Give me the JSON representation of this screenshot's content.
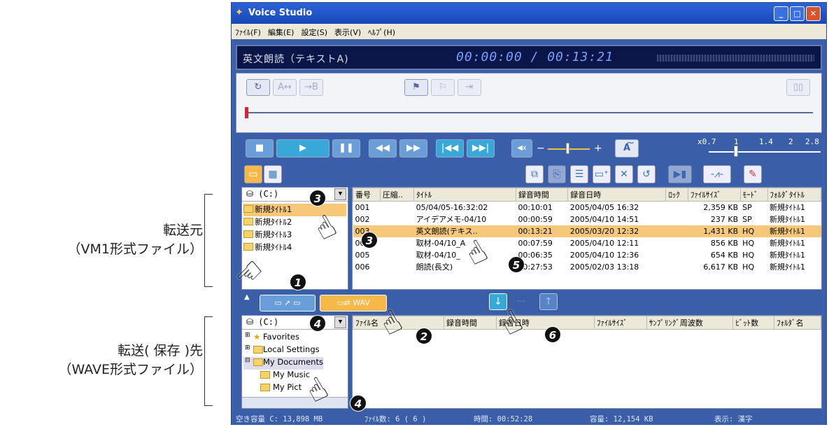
{
  "left_labels": {
    "source_line1": "転送元",
    "source_line2": "（VM1形式ファイル）",
    "dest_line1": "転送( 保存 )先",
    "dest_line2": "（WAVE形式ファイル）"
  },
  "window": {
    "title": "Voice Studio",
    "controls": [
      "_",
      "□",
      "✕"
    ]
  },
  "menu": [
    "ﾌｧｲﾙ(F)",
    "編集(E)",
    "設定(S)",
    "表示(V)",
    "ﾍﾙﾌﾟ(H)"
  ],
  "lcd": {
    "title": "英文朗読（テキストA)",
    "time": "00:00:00 / 00:13:21"
  },
  "speed_scale": {
    "labels": [
      "x0.7",
      "1",
      "1.4",
      "2",
      "2.8"
    ]
  },
  "source_panel": {
    "drive": "(C:)",
    "folders": [
      "新規ﾀｲﾄﾙ1",
      "新規ﾀｲﾄﾙ2",
      "新規ﾀｲﾄﾙ3",
      "新規ﾀｲﾄﾙ4"
    ],
    "columns": [
      "番号",
      "圧縮..",
      "ﾀｲﾄﾙ",
      "録音時間",
      "録音日時",
      "ﾛｯｸ",
      "ﾌｧｲﾙｻｲｽﾞ",
      "ﾓｰﾄﾞ",
      "ﾌｫﾙﾀﾞﾀｲﾄﾙ"
    ],
    "rows": [
      [
        "001",
        "",
        "05/04/05-16:32:02",
        "00:10:01",
        "2005/04/05 16:32",
        "",
        "2,359 KB",
        "SP",
        "新規ﾀｲﾄﾙ1"
      ],
      [
        "002",
        "",
        "アイデアメモ-04/10",
        "00:00:59",
        "2005/04/10 14:51",
        "",
        "237 KB",
        "SP",
        "新規ﾀｲﾄﾙ1"
      ],
      [
        "003",
        "",
        "英文朗読(テキス..",
        "00:13:21",
        "2005/03/20 12:32",
        "",
        "1,431 KB",
        "HQ",
        "新規ﾀｲﾄﾙ1"
      ],
      [
        "004",
        "",
        "取材-04/10_A",
        "00:07:59",
        "2005/04/10 12:11",
        "",
        "856 KB",
        "HQ",
        "新規ﾀｲﾄﾙ1"
      ],
      [
        "005",
        "",
        "取材-04/10_",
        "00:06:35",
        "2005/04/10 12:36",
        "",
        "654 KB",
        "HQ",
        "新規ﾀｲﾄﾙ1"
      ],
      [
        "006",
        "",
        "朗読(長文)",
        "00:27:53",
        "2005/02/03 13:18",
        "",
        "6,617 KB",
        "HQ",
        "新規ﾀｲﾄﾙ1"
      ]
    ]
  },
  "dest_panel": {
    "drive": "(C:)",
    "tree": [
      "Favorites",
      "Local Settings",
      "My Documents",
      "My Music",
      "My Pict"
    ],
    "columns": [
      "ﾌｧｲﾙ名",
      "録音時間",
      "録音日時",
      "ﾌｧｲﾙｻｲｽﾞ",
      "ｻﾝﾌﾟﾘﾝｸﾞ周波数",
      "ﾋﾞｯﾄ数",
      "ﾌｫﾙﾀﾞ名"
    ],
    "wav_label": "WAV"
  },
  "status": {
    "free": "空き容量 C: 13,898 MB",
    "files": "ﾌｧｲﾙ数: 6 ( 6 )",
    "time": "時間: 00:52:28",
    "size": "容量: 12,154 KB",
    "view": "表示: 漢字"
  },
  "badges": {
    "b1": "1",
    "b2": "2",
    "b3": "3",
    "b3b": "3",
    "b4": "4",
    "b4b": "4",
    "b5": "5",
    "b6": "6"
  }
}
